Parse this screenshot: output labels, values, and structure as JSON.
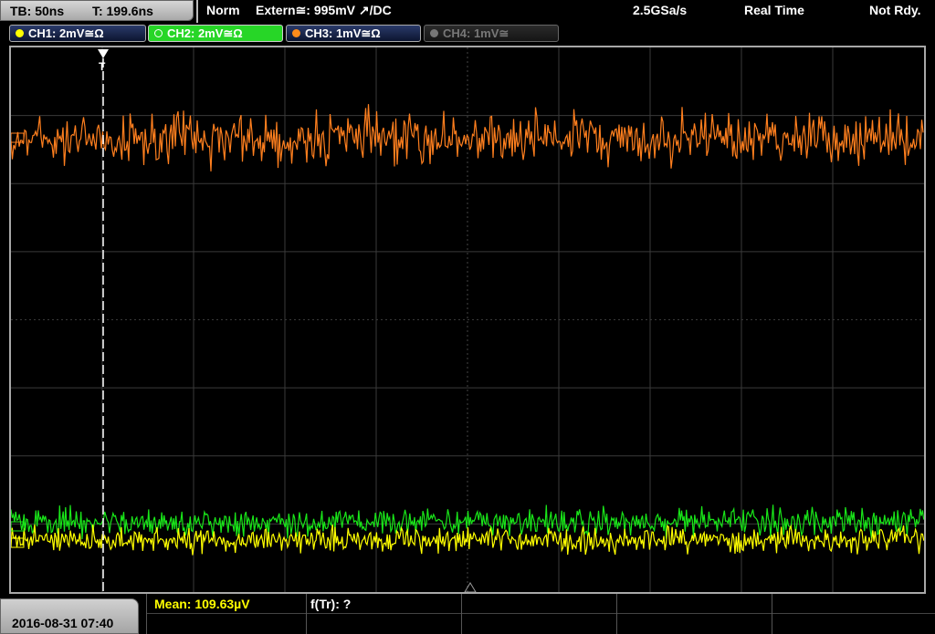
{
  "topbar": {
    "timebase": "TB: 50ns",
    "trigger_time": "T: 199.6ns",
    "trigger_mode": "Norm",
    "trigger_source": "Extern≅: 995mV ↗/DC",
    "sample_rate": "2.5GSa/s",
    "acq_mode": "Real Time",
    "status": "Not Rdy."
  },
  "channels": [
    {
      "label": "CH1: 2mV≅Ω",
      "color": "#ffff00",
      "state": "normal"
    },
    {
      "label": "CH2: 2mV≅Ω",
      "color": "#22dd22",
      "state": "active"
    },
    {
      "label": "CH3: 1mV≅Ω",
      "color": "#ff8c1a",
      "state": "normal"
    },
    {
      "label": "CH4: 1mV≅",
      "color": "#777777",
      "state": "disabled"
    }
  ],
  "traces": {
    "ch3_color": "#ff7f1e",
    "ch2_color": "#19e619",
    "ch1_color": "#ffff00",
    "grid_color": "#3a3a3a"
  },
  "trigger_marker": {
    "label": "T"
  },
  "bottombar": {
    "datetime": "2016-08-31 07:40",
    "mean": "Mean: 109.63µV",
    "ftr": "f(Tr): ?"
  }
}
